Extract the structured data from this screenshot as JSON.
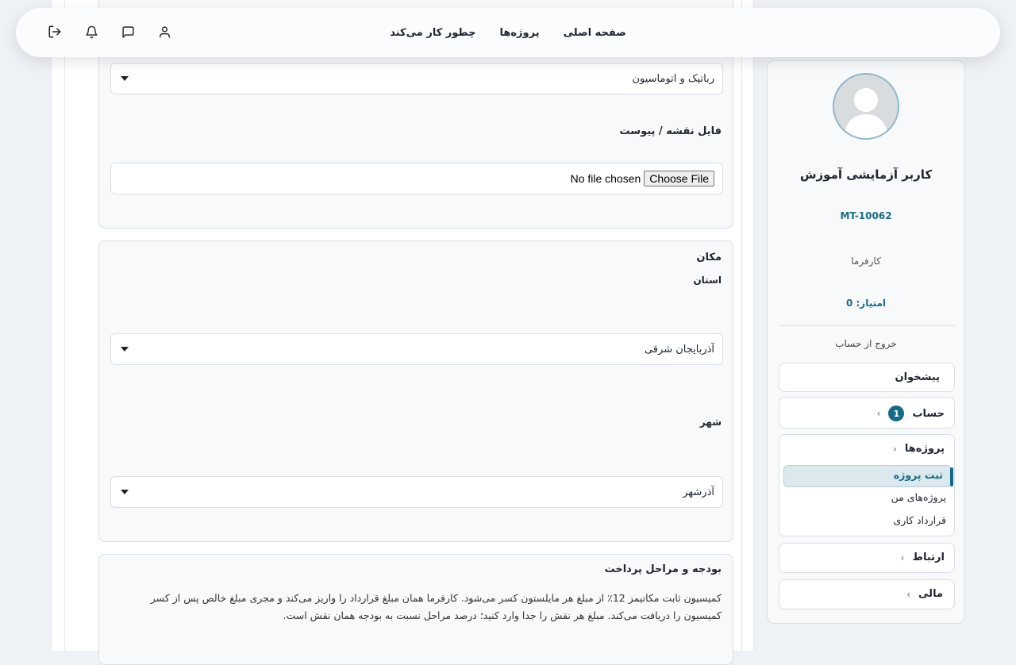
{
  "nav": {
    "links": [
      "صفحه اصلی",
      "پروژه‌ها",
      "چطور کار می‌کند"
    ]
  },
  "form": {
    "category_value": "رباتیک و اتوماسیون",
    "attachment_label": "فایل نقشه / پیوست",
    "file_button": "Choose File",
    "file_status": "No file chosen",
    "location_title": "مکان",
    "province_label": "استان",
    "province_value": "آذربایجان شرقی",
    "city_label": "شهر",
    "city_value": "آذرشهر",
    "budget_title": "بودجه و مراحل پرداخت",
    "budget_desc": "کمیسیون ثابت مکاتیمز 12٪ از مبلغ هر مایلستون کسر می‌شود. کارفرما همان مبلغ قرارداد را واریز می‌کند و مجری مبلغ خالص پس از کسر کمیسیون را دریافت می‌کند. مبلغ هر نقش را جدا وارد کنید؛ درصد مراحل نسبت به بودجه همان نقش است."
  },
  "sidebar": {
    "user_name": "کاربر آزمایشی آموزش",
    "user_code": "MT-10062",
    "role": "کارفرما",
    "score": "امتیاز: 0",
    "logout": "خروج از حساب",
    "menu": {
      "dashboard": "پیشخوان",
      "account": "حساب",
      "account_badge": "1",
      "projects": "پروژه‌ها",
      "projects_items": [
        "ثبت پروژه",
        "پروژه‌های من",
        "قرارداد کاری"
      ],
      "communication": "ارتباط",
      "finance": "مالی"
    }
  },
  "colors": {
    "accent": "#156b86",
    "active_bg": "#dbe9ee"
  }
}
